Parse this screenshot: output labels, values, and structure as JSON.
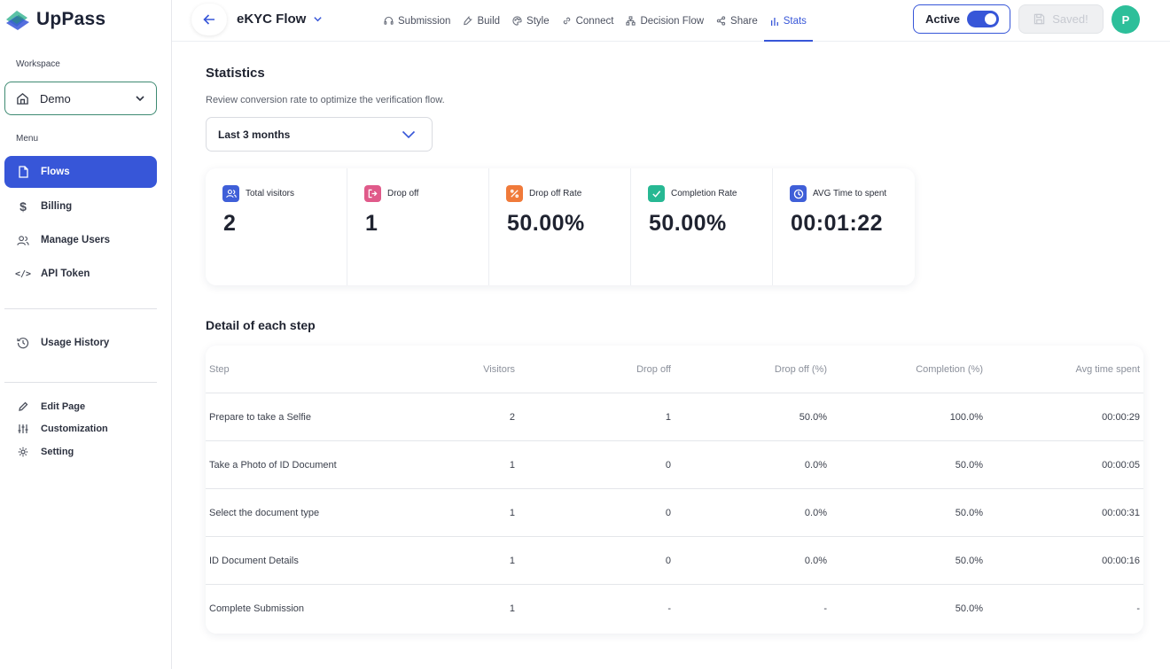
{
  "app": {
    "name": "UpPass",
    "colors": {
      "primary": "#3756d8",
      "brand_teal": "#2dbf9a",
      "workspace_border": "#3e8a72"
    }
  },
  "sidebar": {
    "workspace_label": "Workspace",
    "workspace_value": "Demo",
    "menu_label": "Menu",
    "menu_items": [
      {
        "label": "Flows",
        "icon": "file-icon",
        "active": true
      },
      {
        "label": "Billing",
        "icon": "dollar-icon",
        "active": false
      },
      {
        "label": "Manage Users",
        "icon": "users-icon",
        "active": false
      },
      {
        "label": "API Token",
        "icon": "code-icon",
        "active": false
      }
    ],
    "usage_history": "Usage History",
    "bottom_items": [
      {
        "label": "Edit Page",
        "icon": "pencil-icon"
      },
      {
        "label": "Customization",
        "icon": "sliders-icon"
      },
      {
        "label": "Setting",
        "icon": "gear-icon"
      }
    ]
  },
  "header": {
    "flow_title": "eKYC Flow",
    "tabs": [
      {
        "label": "Submission",
        "icon": "headset-icon"
      },
      {
        "label": "Build",
        "icon": "wrench-icon"
      },
      {
        "label": "Style",
        "icon": "palette-icon"
      },
      {
        "label": "Connect",
        "icon": "link-icon"
      },
      {
        "label": "Decision Flow",
        "icon": "flow-icon"
      },
      {
        "label": "Share",
        "icon": "share-icon"
      },
      {
        "label": "Stats",
        "icon": "bar-chart-icon",
        "active": true
      }
    ],
    "active_label": "Active",
    "active_toggle_on": true,
    "saved_label": "Saved!",
    "avatar_initial": "P"
  },
  "stats": {
    "title": "Statistics",
    "subtitle": "Review conversion rate to optimize the verification flow.",
    "period": "Last 3 months",
    "cards": [
      {
        "label": "Total visitors",
        "value": "2",
        "icon": "users-icon",
        "color": "#3f5fd8"
      },
      {
        "label": "Drop off",
        "value": "1",
        "icon": "exit-icon",
        "color": "#e05a8a"
      },
      {
        "label": "Drop off Rate",
        "value": "50.00%",
        "icon": "percent-icon",
        "color": "#f07a3a"
      },
      {
        "label": "Completion Rate",
        "value": "50.00%",
        "icon": "check-icon",
        "color": "#27b893"
      },
      {
        "label": "AVG Time to spent",
        "value": "00:01:22",
        "icon": "clock-icon",
        "color": "#3f5fd8"
      }
    ]
  },
  "detail": {
    "title": "Detail of each step",
    "columns": [
      "Step",
      "Visitors",
      "Drop off",
      "Drop off (%)",
      "Completion (%)",
      "Avg time spent"
    ],
    "rows": [
      [
        "Prepare to take a Selfie",
        "2",
        "1",
        "50.0%",
        "100.0%",
        "00:00:29"
      ],
      [
        "Take a Photo of ID Document",
        "1",
        "0",
        "0.0%",
        "50.0%",
        "00:00:05"
      ],
      [
        "Select the document type",
        "1",
        "0",
        "0.0%",
        "50.0%",
        "00:00:31"
      ],
      [
        "ID Document Details",
        "1",
        "0",
        "0.0%",
        "50.0%",
        "00:00:16"
      ],
      [
        "Complete Submission",
        "1",
        "-",
        "-",
        "50.0%",
        "-"
      ]
    ]
  }
}
